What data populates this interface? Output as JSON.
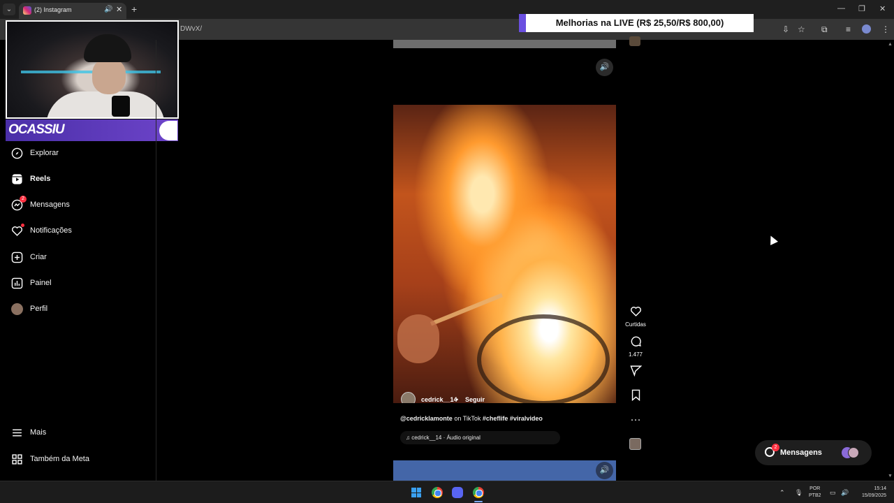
{
  "browser": {
    "tab_menu": "⌄",
    "tab_title": "(2) Instagram",
    "tab_audio_icon": "speaker-icon",
    "tab_close": "✕",
    "new_tab": "+",
    "window_controls": [
      "—",
      "❐",
      "✕"
    ],
    "url_fragment": "DWvX/",
    "toolbar_icons": [
      "install-icon",
      "star-icon",
      "extensions-icon",
      "media-icon",
      "profile-icon",
      "menu-icon"
    ]
  },
  "overlay": {
    "banner": "Melhorias na LIVE (R$ 25,50/R$ 800,00)",
    "streamer_name": "OCASSIU"
  },
  "sidebar": {
    "items": [
      {
        "label": "Explorar",
        "icon": "compass-icon"
      },
      {
        "label": "Reels",
        "icon": "reels-icon"
      },
      {
        "label": "Mensagens",
        "icon": "messenger-icon",
        "badge": "2"
      },
      {
        "label": "Notificações",
        "icon": "heart-icon"
      },
      {
        "label": "Criar",
        "icon": "plus-square-icon"
      },
      {
        "label": "Painel",
        "icon": "chart-icon"
      },
      {
        "label": "Perfil",
        "icon": "avatar"
      }
    ],
    "bottom": [
      {
        "label": "Mais",
        "icon": "hamburger-icon"
      },
      {
        "label": "Também da Meta",
        "icon": "meta-icon"
      }
    ]
  },
  "reel": {
    "username": "cedrick__14",
    "separator": "•",
    "follow": "Seguir",
    "caption_handle": "@cedricklamonte",
    "caption_text": " on TikTok ",
    "caption_tags": "#cheflife #viralvideo",
    "audio": "♫ cedrick__14 · Áudio original",
    "sound_icon": "🔊"
  },
  "actions": {
    "like_label": "Curtidas",
    "comments_count": "1.477"
  },
  "messages_pill": {
    "label": "Mensagens",
    "count": "2"
  },
  "taskbar": {
    "lang_line1": "POR",
    "lang_line2": "PTB2",
    "time": "15:14",
    "date": "15/09/2025"
  },
  "colors": {
    "accent_badge": "#ff3040",
    "banner_accent": "#6a4fe0"
  }
}
